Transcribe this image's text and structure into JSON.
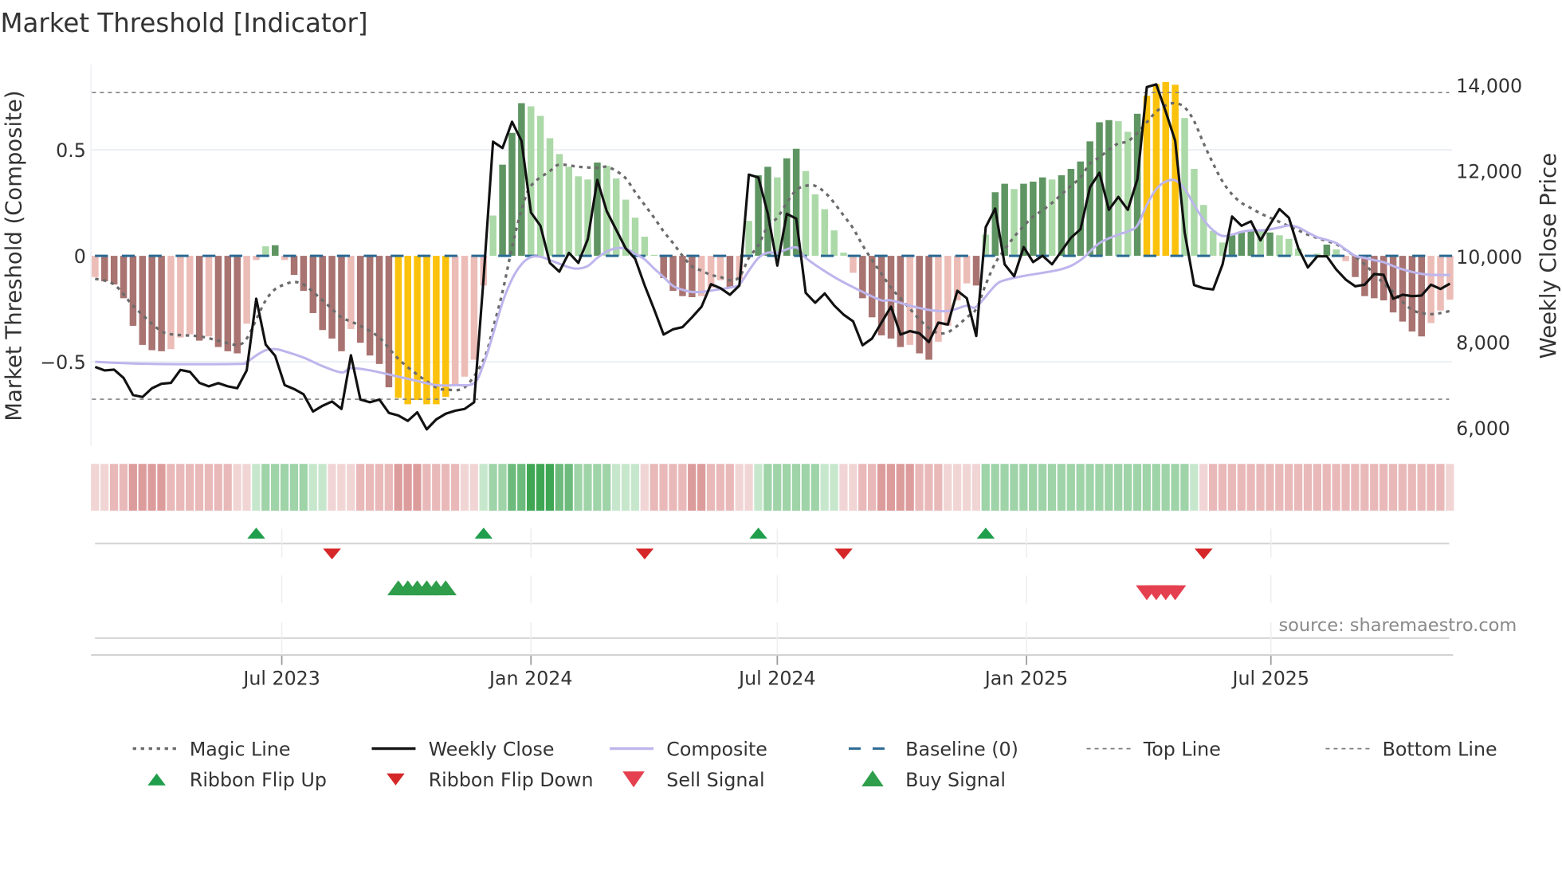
{
  "chart_data": {
    "type": "bar",
    "title": "Market Threshold [Indicator]",
    "ylabel_left": "Market Threshold (Composite)",
    "ylabel_right": "Weekly Close Price",
    "source": "source: sharemaestro.com",
    "ylim_left": [
      -0.94,
      0.9
    ],
    "ylim_right": [
      5700,
      14900
    ],
    "left_ticks": [
      {
        "v": 0.5,
        "label": "0.5"
      },
      {
        "v": 0,
        "label": "0"
      },
      {
        "v": -0.5,
        "label": "−0.5"
      }
    ],
    "right_ticks": [
      {
        "v": 14000,
        "label": "14,000"
      },
      {
        "v": 12000,
        "label": "12,000"
      },
      {
        "v": 10000,
        "label": "10,000"
      },
      {
        "v": 8000,
        "label": "8,000"
      },
      {
        "v": 6000,
        "label": "6,000"
      }
    ],
    "x_ticks": [
      {
        "week": 20.7,
        "label": "Jul 2023"
      },
      {
        "week": 47.0,
        "label": "Jan 2024"
      },
      {
        "week": 73.0,
        "label": "Jul 2024"
      },
      {
        "week": 99.3,
        "label": "Jan 2025"
      },
      {
        "week": 125.1,
        "label": "Jul 2025"
      }
    ],
    "top_line": 0.77,
    "bottom_line": -0.676,
    "baseline": 0,
    "colors": {
      "dr": "#a87370",
      "lr": "#ecbcb7",
      "lg": "#acd9a8",
      "dg": "#5f9562",
      "y": "#fbc20d",
      "magic": "#6b6b6b",
      "close": "#111111",
      "composite": "#bdb5ec",
      "baseline": "#2b6a94",
      "threshold": "#808080",
      "flip_up": "#1f9e4b",
      "flip_down": "#d62728",
      "buy": "#2e9e4a",
      "sell": "#e5404f",
      "ribbon_pos": [
        "#c7e7cd",
        "#9fd3a8",
        "#6dbb7c",
        "#3fa653"
      ],
      "ribbon_neg": [
        "#f1d5d5",
        "#e9b9b9",
        "#dd9c9c",
        "#d08686"
      ]
    },
    "composite_bars": [
      -0.1,
      -0.12,
      -0.135,
      -0.2,
      -0.33,
      -0.42,
      -0.445,
      -0.45,
      -0.44,
      -0.385,
      -0.37,
      -0.4,
      -0.38,
      -0.43,
      -0.45,
      -0.46,
      -0.32,
      -0.02,
      0.045,
      0.05,
      -0.02,
      -0.09,
      -0.165,
      -0.27,
      -0.35,
      -0.39,
      -0.45,
      -0.345,
      -0.41,
      -0.47,
      -0.51,
      -0.62,
      -0.67,
      -0.7,
      -0.68,
      -0.7,
      -0.7,
      -0.665,
      -0.61,
      -0.57,
      -0.49,
      -0.14,
      0.19,
      0.43,
      0.58,
      0.72,
      0.705,
      0.66,
      0.555,
      0.48,
      0.42,
      0.375,
      0.36,
      0.44,
      0.425,
      0.365,
      0.265,
      0.18,
      0.09,
      0.005,
      -0.105,
      -0.165,
      -0.19,
      -0.195,
      -0.19,
      -0.15,
      -0.115,
      -0.15,
      -0.11,
      0.165,
      0.38,
      0.42,
      0.37,
      0.46,
      0.505,
      0.4,
      0.29,
      0.22,
      0.12,
      0.015,
      -0.08,
      -0.2,
      -0.29,
      -0.375,
      -0.39,
      -0.43,
      -0.42,
      -0.46,
      -0.49,
      -0.405,
      -0.33,
      -0.21,
      -0.13,
      -0.14,
      0.1,
      0.3,
      0.34,
      0.315,
      0.34,
      0.35,
      0.37,
      0.36,
      0.38,
      0.41,
      0.445,
      0.54,
      0.63,
      0.64,
      0.635,
      0.585,
      0.67,
      0.755,
      0.81,
      0.82,
      0.807,
      0.65,
      0.41,
      0.24,
      0.118,
      0.063,
      0.097,
      0.115,
      0.12,
      0.12,
      0.11,
      0.097,
      0.08,
      0.034,
      0.005,
      0.01,
      0.053,
      0.03,
      -0.025,
      -0.1,
      -0.19,
      -0.2,
      -0.21,
      -0.267,
      -0.31,
      -0.357,
      -0.38,
      -0.317,
      -0.258,
      -0.207
    ],
    "bar_types": [
      "lr",
      "dr",
      "dr",
      "dr",
      "dr",
      "dr",
      "dr",
      "dr",
      "lr",
      "lr",
      "lr",
      "dr",
      "lr",
      "dr",
      "dr",
      "dr",
      "lr",
      "lr",
      "lg",
      "dg",
      "lr",
      "dr",
      "dr",
      "dr",
      "dr",
      "dr",
      "dr",
      "lr",
      "dr",
      "dr",
      "dr",
      "dr",
      "y",
      "y",
      "y",
      "y",
      "y",
      "y",
      "lr",
      "lr",
      "lr",
      "lr",
      "lg",
      "dg",
      "dg",
      "dg",
      "lg",
      "lg",
      "lg",
      "lg",
      "lg",
      "lg",
      "lg",
      "dg",
      "lg",
      "lg",
      "lg",
      "lg",
      "lg",
      "lg",
      "dr",
      "dr",
      "dr",
      "dr",
      "lr",
      "lr",
      "lr",
      "dr",
      "lr",
      "lg",
      "dg",
      "dg",
      "lg",
      "dg",
      "dg",
      "lg",
      "lg",
      "lg",
      "lg",
      "lg",
      "lr",
      "dr",
      "dr",
      "dr",
      "dr",
      "dr",
      "lr",
      "dr",
      "dr",
      "lr",
      "lr",
      "lr",
      "lr",
      "dr",
      "lg",
      "dg",
      "dg",
      "lg",
      "dg",
      "dg",
      "dg",
      "lg",
      "dg",
      "dg",
      "dg",
      "dg",
      "dg",
      "dg",
      "lg",
      "lg",
      "dg",
      "y",
      "y",
      "y",
      "y",
      "lg",
      "lg",
      "lg",
      "lg",
      "lg",
      "dg",
      "dg",
      "dg",
      "lg",
      "dg",
      "lg",
      "lg",
      "lg",
      "lg",
      "lg",
      "dg",
      "lg",
      "lr",
      "dr",
      "dr",
      "dr",
      "dr",
      "dr",
      "dr",
      "dr",
      "dr",
      "lr",
      "lr",
      "lr"
    ],
    "weekly_close": [
      7427,
      7346,
      7365,
      7173,
      6770,
      6726,
      6931,
      7036,
      7055,
      7359,
      7315,
      7055,
      6974,
      7049,
      6974,
      6931,
      7346,
      9020,
      7948,
      7687,
      7005,
      6912,
      6788,
      6385,
      6522,
      6621,
      6447,
      7700,
      6664,
      6602,
      6664,
      6354,
      6292,
      6168,
      6367,
      5970,
      6200,
      6336,
      6404,
      6447,
      6602,
      9500,
      12691,
      12542,
      13156,
      12709,
      11035,
      10725,
      9857,
      9653,
      10093,
      9857,
      10415,
      11798,
      11066,
      10632,
      10198,
      9950,
      9330,
      8772,
      8183,
      8307,
      8357,
      8586,
      8834,
      9361,
      9268,
      9113,
      9330,
      11922,
      11854,
      11004,
      9795,
      11004,
      10893,
      9157,
      8927,
      9144,
      8865,
      8648,
      8493,
      7935,
      8090,
      8462,
      8834,
      8183,
      8264,
      8214,
      8010,
      8462,
      8419,
      9206,
      9033,
      8152,
      10694,
      11128,
      9826,
      9547,
      10229,
      9876,
      10025,
      9826,
      10136,
      10446,
      10645,
      11624,
      11965,
      11097,
      11400,
      11097,
      11810,
      13968,
      14030,
      13391,
      12709,
      10570,
      9343,
      9268,
      9237,
      9826,
      10942,
      10725,
      10831,
      10384,
      10756,
      11116,
      10911,
      10198,
      9752,
      10012,
      10012,
      9702,
      9467,
      9312,
      9349,
      9597,
      9578,
      9020,
      9113,
      9082,
      9095,
      9349,
      9250,
      9374
    ],
    "composite_line": [
      [
        1,
        -0.5
      ],
      [
        7,
        -0.51
      ],
      [
        16,
        -0.51
      ],
      [
        17,
        -0.5
      ],
      [
        18,
        -0.47
      ],
      [
        19,
        -0.445
      ],
      [
        20,
        -0.44
      ],
      [
        21,
        -0.45
      ],
      [
        23,
        -0.48
      ],
      [
        25,
        -0.52
      ],
      [
        27,
        -0.55
      ],
      [
        28,
        -0.53
      ],
      [
        30,
        -0.54
      ],
      [
        33,
        -0.57
      ],
      [
        35,
        -0.59
      ],
      [
        37,
        -0.61
      ],
      [
        39,
        -0.61
      ],
      [
        41,
        -0.6
      ],
      [
        42,
        -0.51
      ],
      [
        43,
        -0.37
      ],
      [
        44,
        -0.22
      ],
      [
        45,
        -0.11
      ],
      [
        46,
        -0.04
      ],
      [
        47,
        -0.006
      ],
      [
        48,
        -0.004
      ],
      [
        49,
        -0.02
      ],
      [
        51,
        -0.054
      ],
      [
        52,
        -0.06
      ],
      [
        53,
        -0.048
      ],
      [
        54,
        -0.01
      ],
      [
        55,
        0.02
      ],
      [
        56,
        0.036
      ],
      [
        57,
        0.034
      ],
      [
        58,
        0.01
      ],
      [
        59,
        -0.017
      ],
      [
        60,
        -0.06
      ],
      [
        61,
        -0.1
      ],
      [
        62,
        -0.142
      ],
      [
        63,
        -0.16
      ],
      [
        64,
        -0.17
      ],
      [
        65,
        -0.17
      ],
      [
        66,
        -0.164
      ],
      [
        67,
        -0.157
      ],
      [
        68,
        -0.15
      ],
      [
        69,
        -0.135
      ],
      [
        70,
        -0.07
      ],
      [
        71,
        -0.01
      ],
      [
        72,
        0.015
      ],
      [
        73,
        0.015
      ],
      [
        75,
        0.04
      ],
      [
        76,
        -0.01
      ],
      [
        79,
        -0.1
      ],
      [
        82,
        -0.17
      ],
      [
        84,
        -0.21
      ],
      [
        85,
        -0.21
      ],
      [
        87,
        -0.235
      ],
      [
        89,
        -0.255
      ],
      [
        91,
        -0.26
      ],
      [
        93,
        -0.235
      ],
      [
        94,
        -0.24
      ],
      [
        96,
        -0.14
      ],
      [
        97,
        -0.115
      ],
      [
        99,
        -0.095
      ],
      [
        103,
        -0.063
      ],
      [
        105,
        -0.02
      ],
      [
        107,
        0.06
      ],
      [
        109,
        0.1
      ],
      [
        110,
        0.115
      ],
      [
        111,
        0.143
      ],
      [
        112,
        0.24
      ],
      [
        113,
        0.315
      ],
      [
        114,
        0.35
      ],
      [
        115,
        0.356
      ],
      [
        116,
        0.315
      ],
      [
        117,
        0.24
      ],
      [
        118,
        0.17
      ],
      [
        119,
        0.12
      ],
      [
        120,
        0.094
      ],
      [
        121,
        0.1
      ],
      [
        122,
        0.113
      ],
      [
        123,
        0.12
      ],
      [
        124,
        0.12
      ],
      [
        125,
        0.125
      ],
      [
        126,
        0.134
      ],
      [
        127,
        0.143
      ],
      [
        128,
        0.134
      ],
      [
        129,
        0.11
      ],
      [
        130,
        0.088
      ],
      [
        131,
        0.075
      ],
      [
        132,
        0.06
      ],
      [
        133,
        0.03
      ],
      [
        134,
        0.0
      ],
      [
        135,
        -0.01
      ],
      [
        136,
        -0.02
      ],
      [
        137,
        -0.03
      ],
      [
        138,
        -0.048
      ],
      [
        139,
        -0.064
      ],
      [
        140,
        -0.076
      ],
      [
        141,
        -0.085
      ],
      [
        142,
        -0.089
      ],
      [
        143,
        -0.09
      ],
      [
        144,
        -0.09
      ]
    ],
    "magic_line": [
      [
        1,
        -0.108
      ],
      [
        3,
        -0.135
      ],
      [
        5,
        -0.235
      ],
      [
        7,
        -0.32
      ],
      [
        8,
        -0.355
      ],
      [
        9,
        -0.37
      ],
      [
        12,
        -0.38
      ],
      [
        14,
        -0.4
      ],
      [
        16,
        -0.42
      ],
      [
        17,
        -0.39
      ],
      [
        18,
        -0.3
      ],
      [
        19,
        -0.21
      ],
      [
        20,
        -0.157
      ],
      [
        21,
        -0.135
      ],
      [
        22,
        -0.123
      ],
      [
        23,
        -0.135
      ],
      [
        24,
        -0.17
      ],
      [
        25,
        -0.21
      ],
      [
        26,
        -0.25
      ],
      [
        27,
        -0.29
      ],
      [
        29,
        -0.33
      ],
      [
        31,
        -0.386
      ],
      [
        33,
        -0.486
      ],
      [
        35,
        -0.56
      ],
      [
        37,
        -0.62
      ],
      [
        38,
        -0.63
      ],
      [
        40,
        -0.62
      ],
      [
        42,
        -0.49
      ],
      [
        43,
        -0.34
      ],
      [
        44,
        -0.17
      ],
      [
        45,
        0.04
      ],
      [
        46,
        0.215
      ],
      [
        47,
        0.33
      ],
      [
        49,
        0.4
      ],
      [
        50,
        0.43
      ],
      [
        52,
        0.42
      ],
      [
        54,
        0.415
      ],
      [
        55,
        0.42
      ],
      [
        56,
        0.4
      ],
      [
        57,
        0.366
      ],
      [
        58,
        0.3
      ],
      [
        59,
        0.24
      ],
      [
        60,
        0.18
      ],
      [
        61,
        0.115
      ],
      [
        62,
        0.06
      ],
      [
        63,
        0.0
      ],
      [
        64,
        -0.05
      ],
      [
        65,
        -0.07
      ],
      [
        66,
        -0.09
      ],
      [
        67,
        -0.1
      ],
      [
        68,
        -0.115
      ],
      [
        69,
        -0.1
      ],
      [
        70,
        -0.01
      ],
      [
        71,
        0.05
      ],
      [
        72,
        0.14
      ],
      [
        73,
        0.18
      ],
      [
        74,
        0.25
      ],
      [
        75,
        0.31
      ],
      [
        76,
        0.33
      ],
      [
        77,
        0.33
      ],
      [
        78,
        0.3
      ],
      [
        79,
        0.25
      ],
      [
        80,
        0.19
      ],
      [
        81,
        0.13
      ],
      [
        82,
        0.05
      ],
      [
        83,
        -0.02
      ],
      [
        84,
        -0.085
      ],
      [
        85,
        -0.15
      ],
      [
        86,
        -0.2
      ],
      [
        87,
        -0.25
      ],
      [
        88,
        -0.3
      ],
      [
        89,
        -0.34
      ],
      [
        90,
        -0.365
      ],
      [
        91,
        -0.36
      ],
      [
        92,
        -0.33
      ],
      [
        93,
        -0.29
      ],
      [
        94,
        -0.25
      ],
      [
        95,
        -0.135
      ],
      [
        96,
        -0.035
      ],
      [
        97,
        0.03
      ],
      [
        98,
        0.09
      ],
      [
        99,
        0.14
      ],
      [
        100,
        0.185
      ],
      [
        101,
        0.215
      ],
      [
        102,
        0.25
      ],
      [
        103,
        0.29
      ],
      [
        104,
        0.33
      ],
      [
        105,
        0.37
      ],
      [
        106,
        0.435
      ],
      [
        107,
        0.465
      ],
      [
        108,
        0.5
      ],
      [
        109,
        0.53
      ],
      [
        110,
        0.54
      ],
      [
        111,
        0.58
      ],
      [
        112,
        0.63
      ],
      [
        113,
        0.68
      ],
      [
        114,
        0.71
      ],
      [
        115,
        0.72
      ],
      [
        116,
        0.7
      ],
      [
        117,
        0.635
      ],
      [
        118,
        0.53
      ],
      [
        119,
        0.435
      ],
      [
        120,
        0.35
      ],
      [
        121,
        0.29
      ],
      [
        122,
        0.25
      ],
      [
        123,
        0.225
      ],
      [
        124,
        0.2
      ],
      [
        125,
        0.18
      ],
      [
        126,
        0.16
      ],
      [
        127,
        0.14
      ],
      [
        128,
        0.12
      ],
      [
        129,
        0.1
      ],
      [
        130,
        0.084
      ],
      [
        131,
        0.07
      ],
      [
        132,
        0.055
      ],
      [
        133,
        0.028
      ],
      [
        134,
        -0.004
      ],
      [
        135,
        -0.04
      ],
      [
        136,
        -0.085
      ],
      [
        137,
        -0.13
      ],
      [
        138,
        -0.17
      ],
      [
        139,
        -0.217
      ],
      [
        140,
        -0.255
      ],
      [
        141,
        -0.27
      ],
      [
        142,
        -0.275
      ],
      [
        143,
        -0.27
      ],
      [
        144,
        -0.26
      ]
    ],
    "ribbon": [
      -1,
      -1,
      -2,
      -2,
      -3,
      -3,
      -3,
      -3,
      -2,
      -2,
      -2,
      -2,
      -2,
      -2,
      -2,
      -1,
      -1,
      1,
      2,
      2,
      2,
      2,
      2,
      1,
      1,
      -1,
      -1,
      -1,
      -2,
      -2,
      -2,
      -2,
      -3,
      -3,
      -3,
      -2,
      -2,
      -2,
      -2,
      -1,
      -1,
      1,
      2,
      2,
      3,
      3,
      4,
      4,
      4,
      3,
      3,
      2,
      2,
      2,
      2,
      1,
      1,
      1,
      -1,
      -2,
      -2,
      -2,
      -2,
      -3,
      -3,
      -2,
      -2,
      -2,
      -1,
      -1,
      1,
      2,
      2,
      2,
      2,
      2,
      2,
      1,
      1,
      -1,
      -1,
      -2,
      -2,
      -3,
      -3,
      -3,
      -3,
      -2,
      -2,
      -2,
      -1,
      -1,
      -1,
      -1,
      2,
      2,
      2,
      2,
      2,
      2,
      2,
      2,
      2,
      2,
      2,
      2,
      2,
      2,
      2,
      2,
      2,
      2,
      2,
      2,
      2,
      2,
      1,
      -1,
      -2,
      -2,
      -2,
      -2,
      -2,
      -2,
      -2,
      -2,
      -2,
      -2,
      -2,
      -2,
      -2,
      -2,
      -2,
      -2,
      -2,
      -2,
      -2,
      -2,
      -2,
      -2,
      -2,
      -2,
      -2,
      -1
    ],
    "ribbon_flip_up": [
      18,
      42,
      71,
      95
    ],
    "ribbon_flip_down": [
      26,
      59,
      80,
      118
    ],
    "buy_signals": [
      33,
      34,
      35,
      36,
      37,
      38
    ],
    "sell_signals": [
      112,
      113,
      114,
      115
    ],
    "legend": [
      {
        "key": "magic",
        "label": "Magic Line",
        "style": "dotted"
      },
      {
        "key": "close",
        "label": "Weekly Close",
        "style": "solid"
      },
      {
        "key": "composite",
        "label": "Composite",
        "style": "solid"
      },
      {
        "key": "baseline",
        "label": "Baseline (0)",
        "style": "dashed"
      },
      {
        "key": "top",
        "label": "Top Line",
        "style": "dotted-thin"
      },
      {
        "key": "bottom",
        "label": "Bottom Line",
        "style": "dotted-thin"
      },
      {
        "key": "flip_up",
        "label": "Ribbon Flip Up",
        "style": "tri-up-small"
      },
      {
        "key": "flip_down",
        "label": "Ribbon Flip Down",
        "style": "tri-down-small"
      },
      {
        "key": "sell",
        "label": "Sell Signal",
        "style": "tri-down"
      },
      {
        "key": "buy",
        "label": "Buy Signal",
        "style": "tri-up"
      }
    ]
  }
}
